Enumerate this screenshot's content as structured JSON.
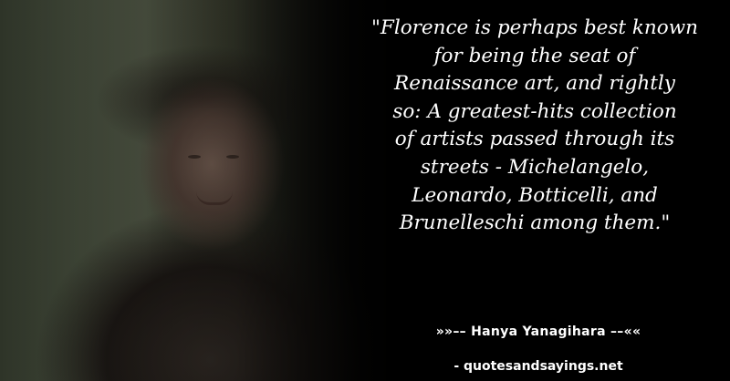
{
  "quote": {
    "lines": [
      "\"Florence is perhaps best known",
      "for being the seat of",
      "Renaissance art, and rightly",
      "so: A greatest-hits collection",
      "of artists passed through its",
      "streets - Michelangelo,",
      "Leonardo, Botticelli, and",
      "Brunelleschi among them.\""
    ],
    "text_color": "#ffffff"
  },
  "attribution": {
    "author_line": "»»–– Hanya Yanagihara ––««",
    "site_line": "- quotesandsayings.net"
  },
  "colors": {
    "background": "#000000"
  }
}
